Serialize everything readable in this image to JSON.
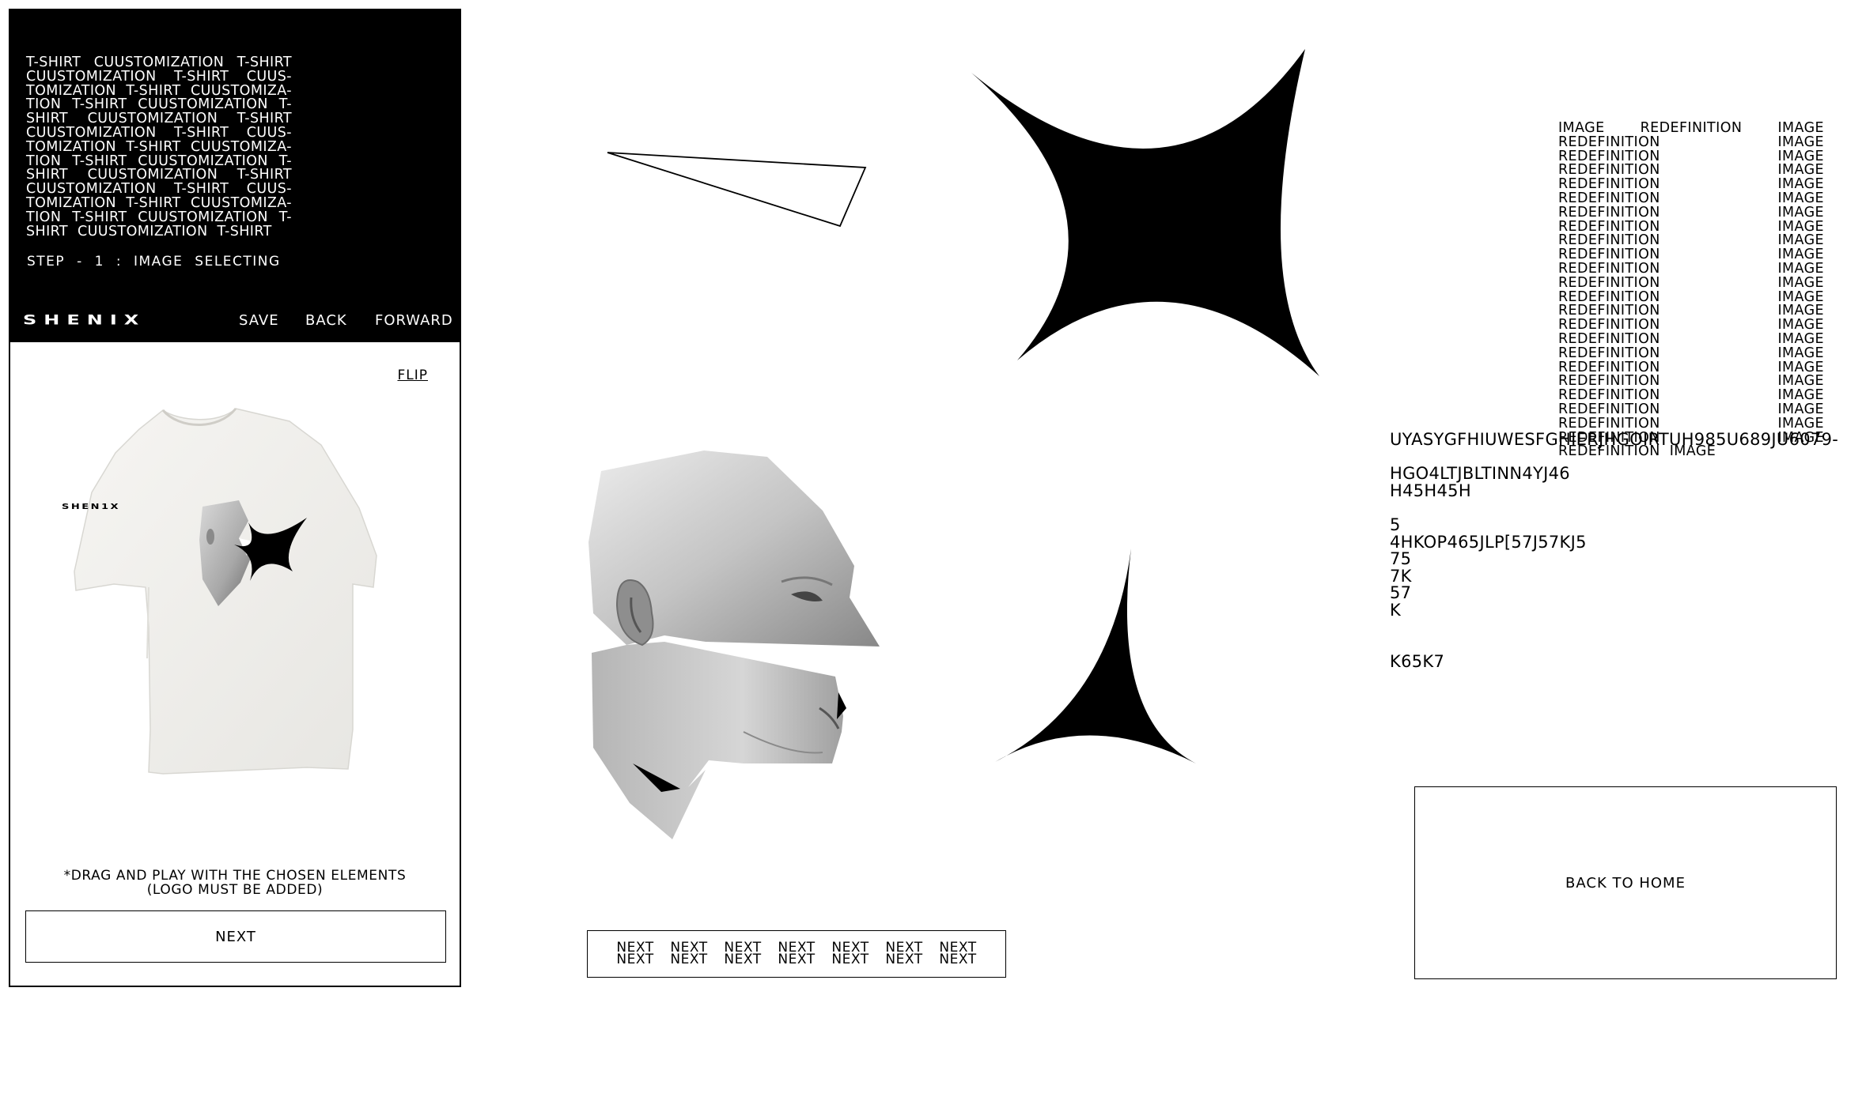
{
  "panel": {
    "repeat_text": "T-SHIRT CUUSTOMIZATION T-SHIRT CUUSTOMIZATION T-SHIRT CUUS-TOMIZATION T-SHIRT CUUSTOMIZA-TION T-SHIRT CUUSTOMIZATION T-SHIRT CUUSTOMIZATION T-SHIRT CUUSTOMIZATION T-SHIRT CUUS-TOMIZATION T-SHIRT CUUSTOMIZA-TION T-SHIRT CUUSTOMIZATION T-SHIRT CUUSTOMIZATION T-SHIRT CUUSTOMIZATION T-SHIRT CUUS-TOMIZATION T-SHIRT CUUSTOMIZA-TION T-SHIRT CUUSTOMIZATION T-SHIRT CUUSTOMIZATION T-SHIRT",
    "step_label": "STEP - 1 : IMAGE SELECTING",
    "brand": "SHENIX",
    "nav": {
      "save": "SAVE",
      "back": "BACK",
      "forward": "FORWARD"
    },
    "flip": "FLIP",
    "shirt_logo": "SHEN1X",
    "drag_note_1": "*DRAG AND PLAY WITH THE  CHOSEN ELEMENTS",
    "drag_note_2": "(LOGO MUST BE ADDED)",
    "next": "NEXT"
  },
  "image_redefinition_text": "IMAGE REDEFINITION IMAGE REDEFINITION IMAGE REDEFINITION IMAGE REDEFINITION IMAGE REDEFINITION IMAGE REDEFINITION IMAGE REDEFINITION IMAGE REDEFINITION IMAGE REDEFINITION IMAGE REDEFINITION IMAGE REDEFINITION IMAGE REDEFINITION IMAGE REDEFINITION IMAGE REDEFINITION IMAGE REDEFINITION IMAGE REDEFINITION IMAGE REDEFINITION IMAGE REDEFINITION IMAGE REDEFINITION IMAGE REDEFINITION IMAGE REDEFINITION IMAGE REDEFINITION IMAGE REDEFINITION IMAGE REDEFINITION IMAGE",
  "code_text": "UYASYGFHIUWESFGHIERJHGOIRTUH985U689JU6079-\n\nHGO4LTJBLTINN4YJ46\nH45H45H\n\n5\n4HKOP465JLP[57J57KJ5\n75\n7K\n57\nK\n\n\nK65K7",
  "home_button": "BACK TO HOME",
  "next_row": [
    [
      "NEXT",
      "NEXT"
    ],
    [
      "NEXT",
      "NEXT"
    ],
    [
      "NEXT",
      "NEXT"
    ],
    [
      "NEXT",
      "NEXT"
    ],
    [
      "NEXT",
      "NEXT"
    ],
    [
      "NEXT",
      "NEXT"
    ],
    [
      "NEXT",
      "NEXT"
    ]
  ],
  "icons": [
    "star-icon",
    "triangle-shape",
    "head-collage-image",
    "tshirt-image"
  ]
}
